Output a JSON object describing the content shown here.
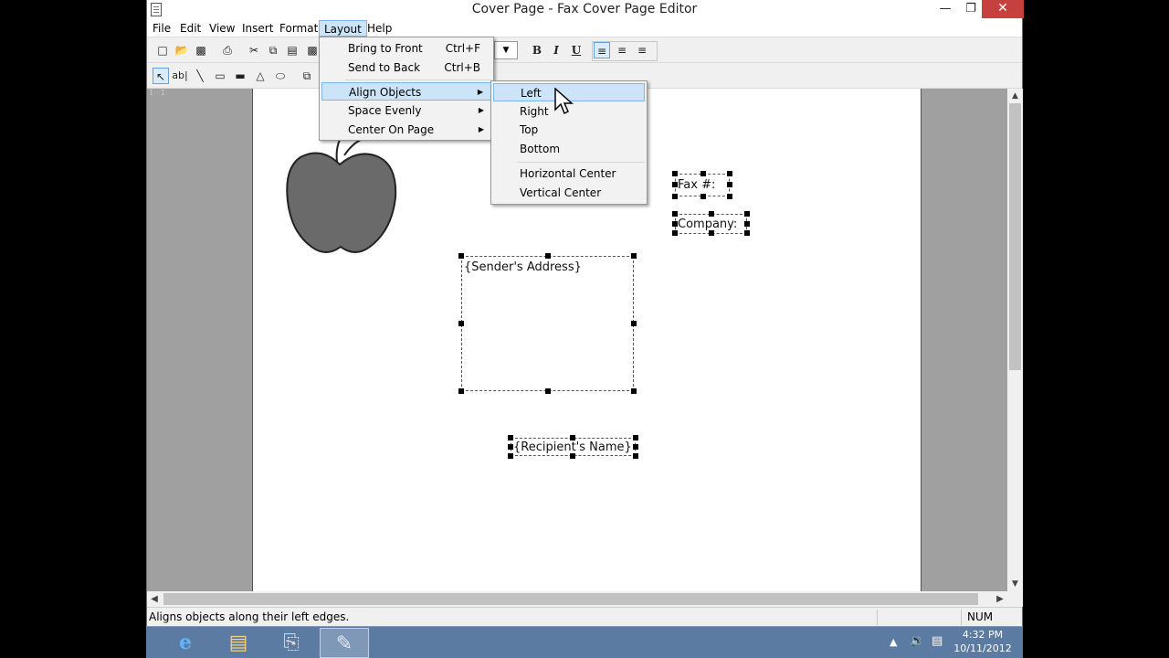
{
  "window": {
    "title": "Cover Page - Fax Cover Page Editor",
    "minimize_glyph": "—",
    "maximize_glyph": "❐",
    "close_glyph": "✕"
  },
  "menubar": {
    "items": [
      "File",
      "Edit",
      "View",
      "Insert",
      "Format",
      "Layout",
      "Help"
    ],
    "active": "Layout"
  },
  "layout_menu": {
    "items": [
      {
        "label": "Bring to Front",
        "shortcut": "Ctrl+F"
      },
      {
        "label": "Send to Back",
        "shortcut": "Ctrl+B"
      },
      {
        "label": "Align Objects",
        "submenu": true
      },
      {
        "label": "Space Evenly",
        "submenu": true
      },
      {
        "label": "Center On Page",
        "submenu": true
      }
    ],
    "highlighted": "Align Objects"
  },
  "align_submenu": {
    "items": [
      "Left",
      "Right",
      "Top",
      "Bottom",
      "Horizontal Center",
      "Vertical Center"
    ],
    "highlighted": "Left"
  },
  "toolbar": {
    "format": {
      "bold": "B",
      "italic": "I",
      "underline": "U"
    }
  },
  "page": {
    "ruler_tag": "1···1",
    "fields": {
      "fax": "Fax #:",
      "company": "Company:",
      "sender_address": "{Sender's Address}",
      "recipient_name": "{Recipient's Name}"
    }
  },
  "statusbar": {
    "text": "Aligns objects along their left edges.",
    "num": "NUM"
  },
  "taskbar": {
    "time": "4:32 PM",
    "date": "10/11/2012"
  },
  "colors": {
    "menu_highlight": "#cce4f7",
    "menu_highlight_border": "#7eb4ea",
    "close_button": "#c74040",
    "taskbar": "#5b7ba3",
    "workspace": "#a0a0a0"
  }
}
